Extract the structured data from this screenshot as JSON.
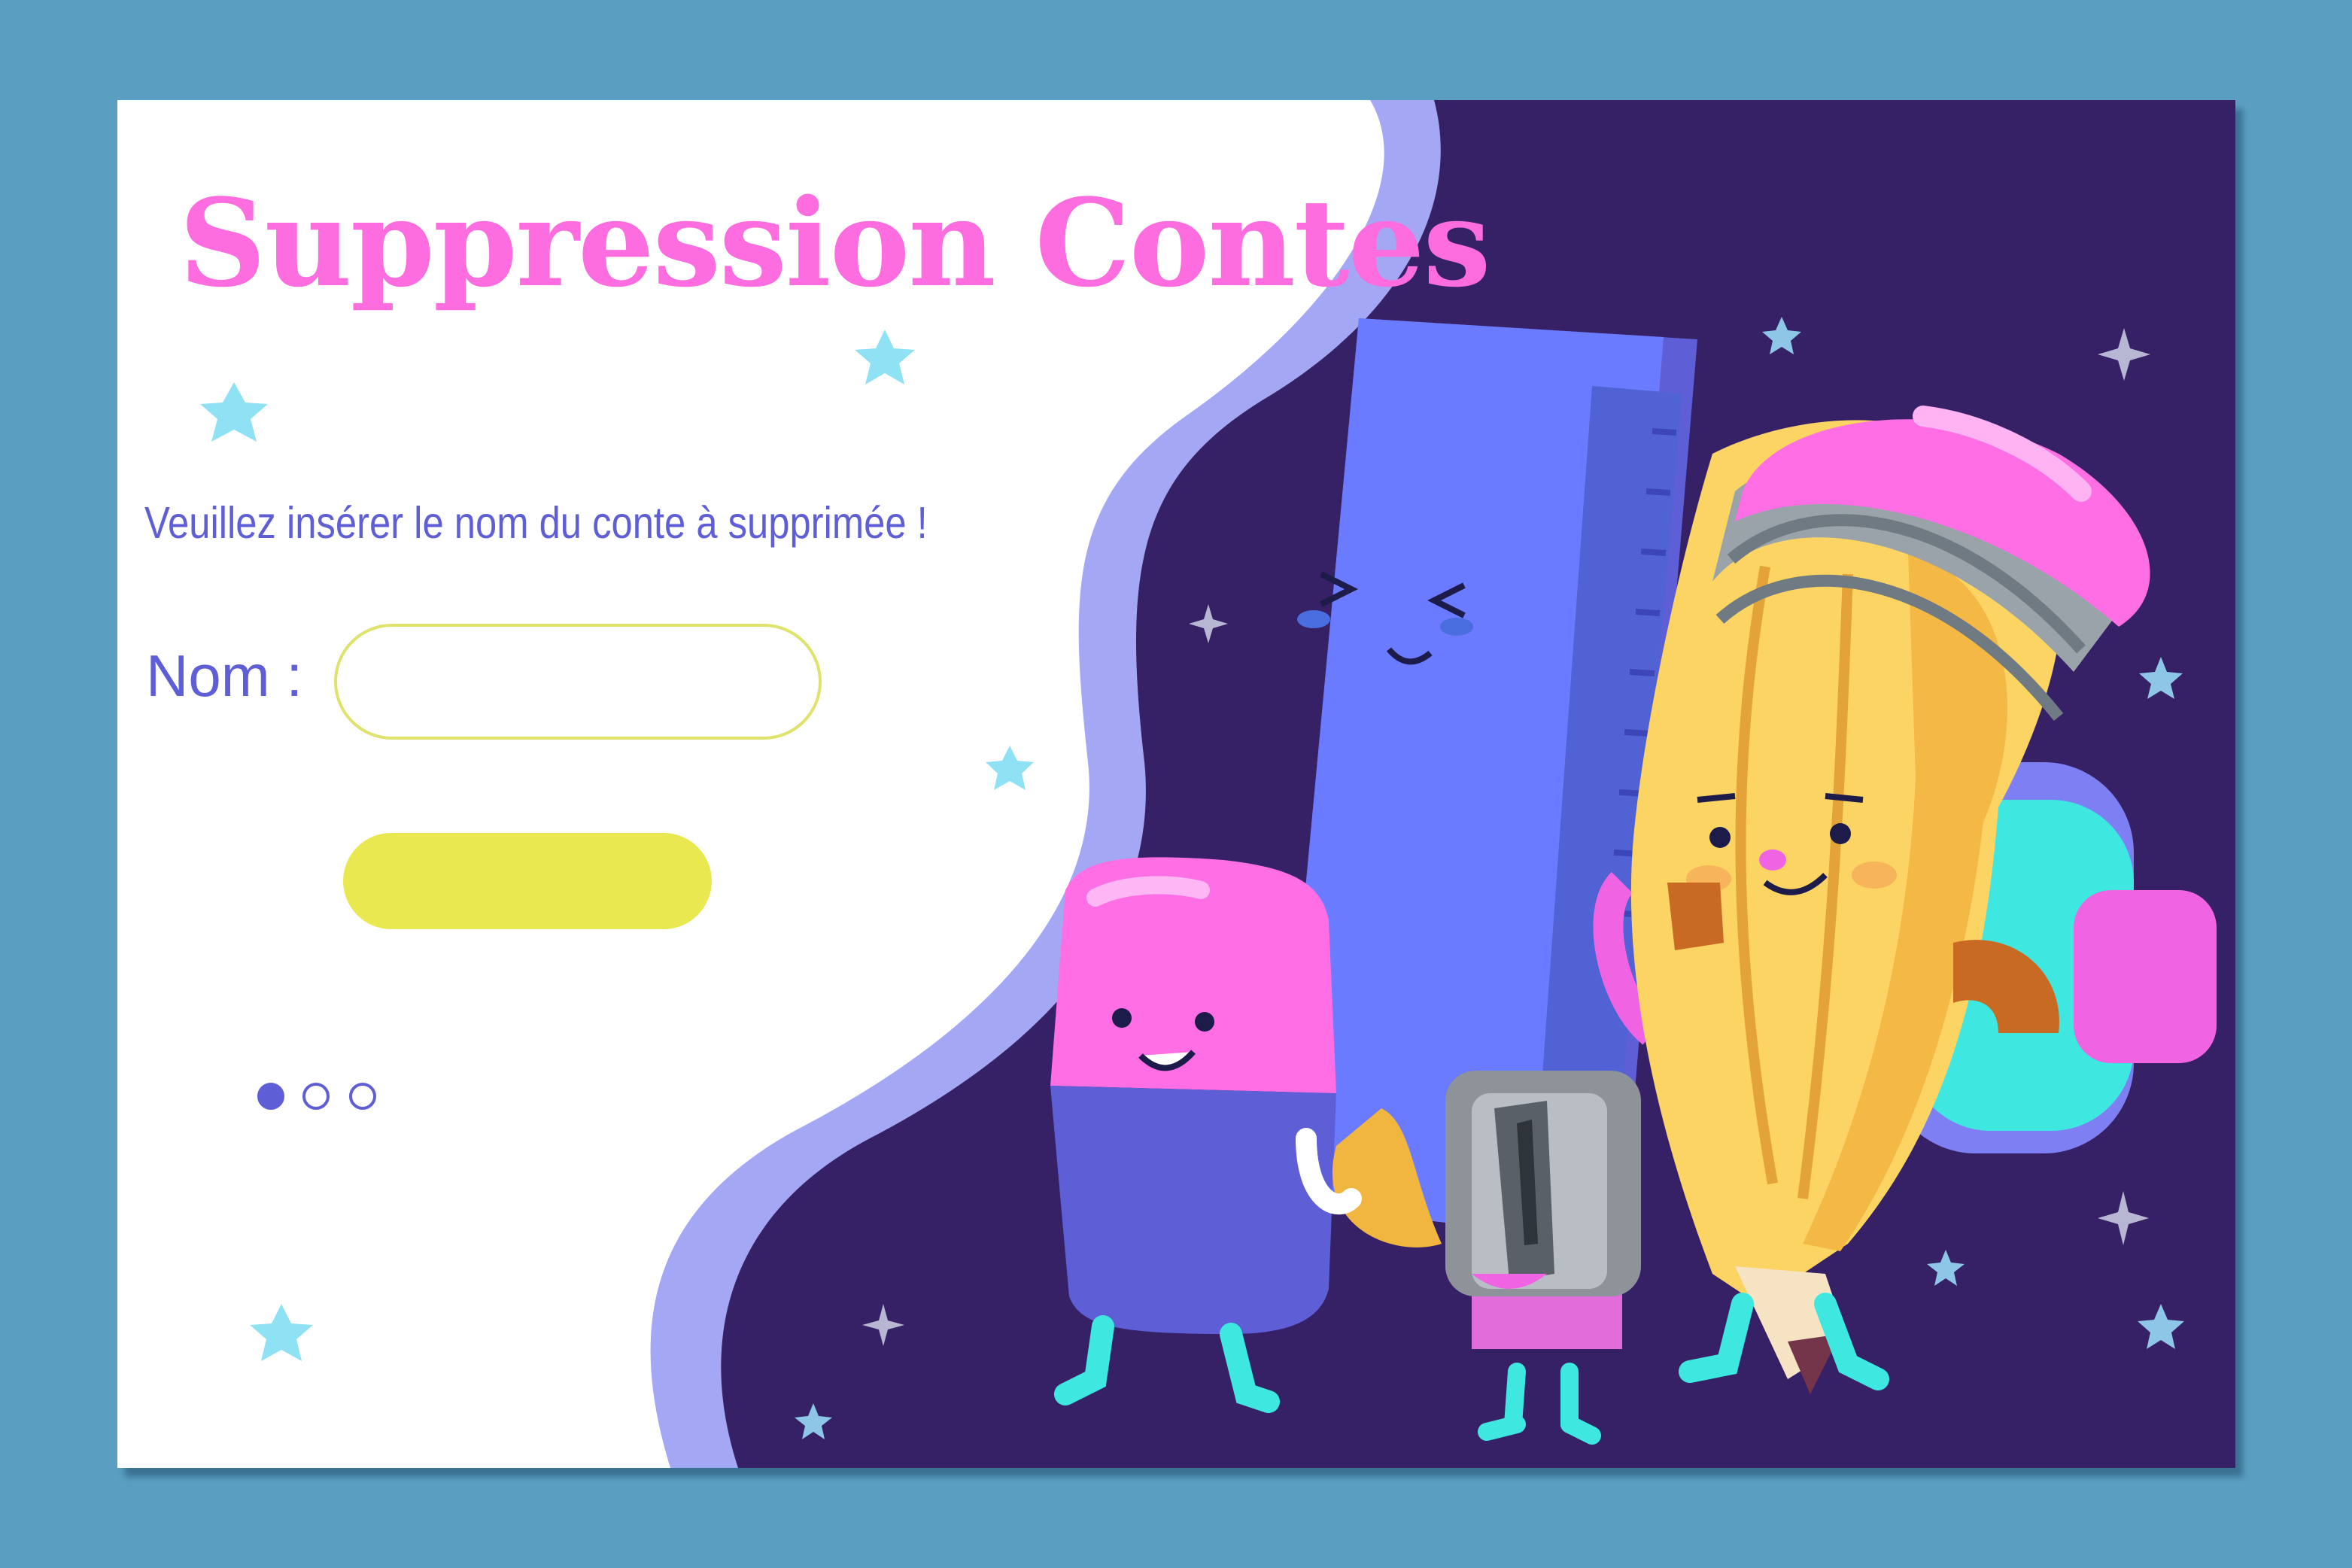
{
  "page": {
    "title": "Suppression Contes",
    "instruction": "Veuillez insérer le nom du conte à supprimée !"
  },
  "form": {
    "name_label": "Nom :",
    "name_value": "",
    "name_placeholder": "",
    "submit_label": ""
  },
  "pagination": {
    "total_pages": 3,
    "active_page": 1
  },
  "colors": {
    "background": "#5a9fc1",
    "card": "#ffffff",
    "title": "#fd6de0",
    "text": "#5e5fd7",
    "input_border": "#dfe36c",
    "button": "#eae850",
    "night_panel": "#362166",
    "wave": "#a4a7f3"
  },
  "illustration": {
    "characters": [
      "ruler",
      "pencil",
      "eraser",
      "sharpener"
    ],
    "decorations": [
      "star-icon"
    ]
  }
}
